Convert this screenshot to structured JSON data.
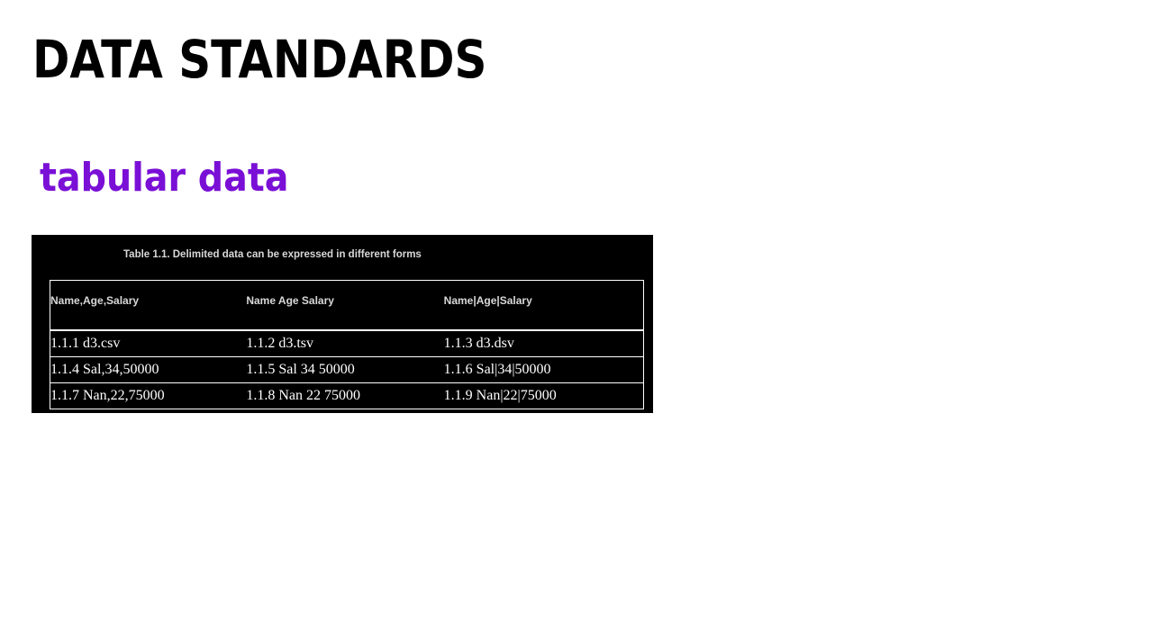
{
  "page": {
    "title": "DATA STANDARDS",
    "section_heading": "tabular data",
    "colors": {
      "title": "#000000",
      "section_heading": "#7a0fd6",
      "panel_background": "#000000",
      "table_text": "#ffffff"
    }
  },
  "table": {
    "caption": "Table 1.1. Delimited data can be expressed in different forms",
    "headers": [
      "Name,Age,Salary",
      "Name Age Salary",
      "Name|Age|Salary"
    ],
    "rows": [
      [
        "1.1.1 d3.csv",
        "1.1.2 d3.tsv",
        "1.1.3 d3.dsv"
      ],
      [
        "1.1.4 Sal,34,50000",
        "1.1.5 Sal 34 50000",
        "1.1.6 Sal|34|50000"
      ],
      [
        "1.1.7 Nan,22,75000",
        "1.1.8 Nan 22 75000",
        "1.1.9 Nan|22|75000"
      ]
    ]
  }
}
